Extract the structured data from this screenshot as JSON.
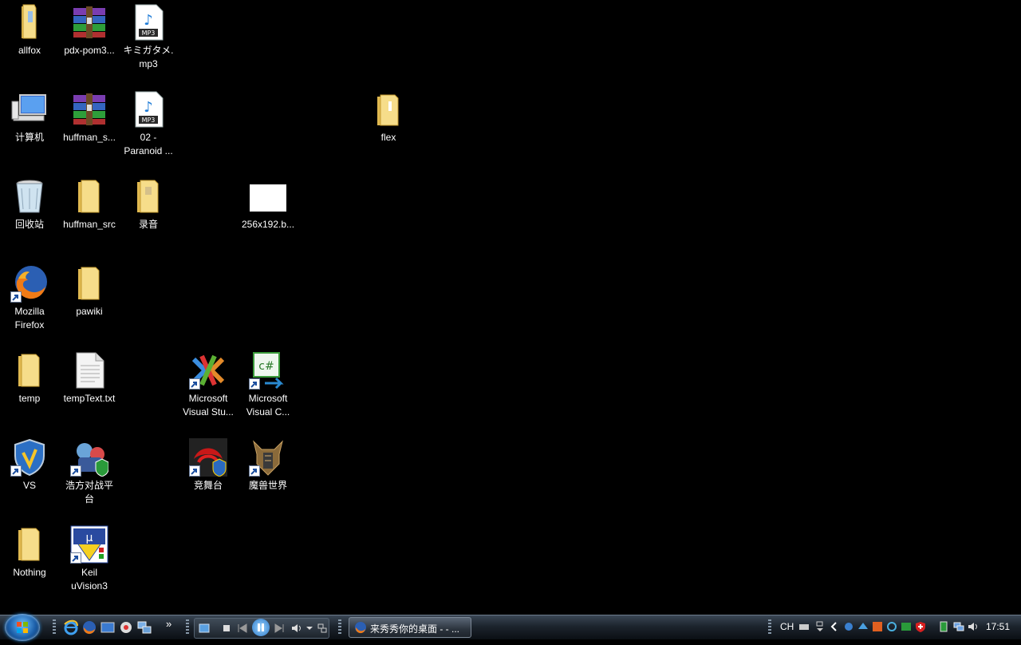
{
  "desktop": {
    "icons": {
      "allfox": "allfox",
      "pdx": "pdx-pom3...",
      "mp3a_1": "キミガタメ.",
      "mp3a_2": "mp3",
      "computer": "计算机",
      "huffman_s": "huffman_s...",
      "mp3b_1": "02 -",
      "mp3b_2": "Paranoid ...",
      "flex": "flex",
      "recycle": "回收站",
      "huffman_src": "huffman_src",
      "luyin": "录音",
      "bmp": "256x192.b...",
      "firefox_1": "Mozilla",
      "firefox_2": "Firefox",
      "pawiki": "pawiki",
      "temp": "temp",
      "temptext": "tempText.txt",
      "vstudio_1": "Microsoft",
      "vstudio_2": "Visual Stu...",
      "vcsharp_1": "Microsoft",
      "vcsharp_2": "Visual C...",
      "vs": "VS",
      "haofang_1": "浩方对战平",
      "haofang_2": "台",
      "jingwutai": "竞舞台",
      "wow": "魔兽世界",
      "nothing": "Nothing",
      "keil_1": "Keil",
      "keil_2": "uVision3"
    }
  },
  "taskbar": {
    "window_title": "来秀秀你的桌面 - - ...",
    "language": "CH",
    "clock": "17:51",
    "chevron": "»"
  },
  "colors": {
    "desktop_bg": "#000000",
    "folder": "#f3d77b",
    "taskbar": "#1c242d"
  }
}
